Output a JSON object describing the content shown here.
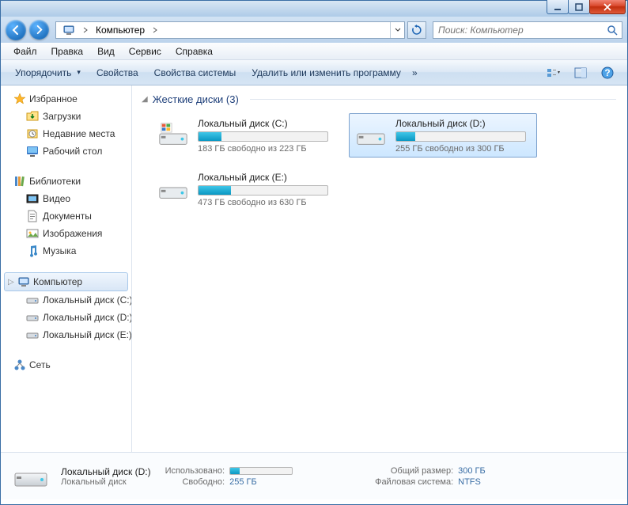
{
  "addressbar": {
    "location": "Компьютер"
  },
  "search": {
    "placeholder": "Поиск: Компьютер"
  },
  "menu": {
    "file": "Файл",
    "edit": "Правка",
    "view": "Вид",
    "tools": "Сервис",
    "help": "Справка"
  },
  "toolbar": {
    "organize": "Упорядочить",
    "properties": "Свойства",
    "system_properties": "Свойства системы",
    "uninstall": "Удалить или изменить программу",
    "more": "»"
  },
  "sidebar": {
    "favorites": {
      "label": "Избранное",
      "items": [
        {
          "label": "Загрузки"
        },
        {
          "label": "Недавние места"
        },
        {
          "label": "Рабочий стол"
        }
      ]
    },
    "libraries": {
      "label": "Библиотеки",
      "items": [
        {
          "label": "Видео"
        },
        {
          "label": "Документы"
        },
        {
          "label": "Изображения"
        },
        {
          "label": "Музыка"
        }
      ]
    },
    "computer": {
      "label": "Компьютер",
      "items": [
        {
          "label": "Локальный диск (C:)"
        },
        {
          "label": "Локальный диск (D:)"
        },
        {
          "label": "Локальный диск (E:)"
        }
      ]
    },
    "network": {
      "label": "Сеть"
    }
  },
  "category": {
    "header": "Жесткие диски (3)"
  },
  "drives": [
    {
      "name": "Локальный диск (C:)",
      "free_text": "183 ГБ свободно из 223 ГБ",
      "used_pct": 18,
      "selected": false,
      "os": true
    },
    {
      "name": "Локальный диск (D:)",
      "free_text": "255 ГБ свободно из 300 ГБ",
      "used_pct": 15,
      "selected": true,
      "os": false
    },
    {
      "name": "Локальный диск (E:)",
      "free_text": "473 ГБ свободно из 630 ГБ",
      "used_pct": 25,
      "selected": false,
      "os": false
    }
  ],
  "details": {
    "name": "Локальный диск (D:)",
    "type": "Локальный диск",
    "labels": {
      "used": "Использовано:",
      "free": "Свободно:",
      "total": "Общий размер:",
      "fs": "Файловая система:"
    },
    "used_pct": 15,
    "free": "255 ГБ",
    "total": "300 ГБ",
    "fs": "NTFS"
  }
}
